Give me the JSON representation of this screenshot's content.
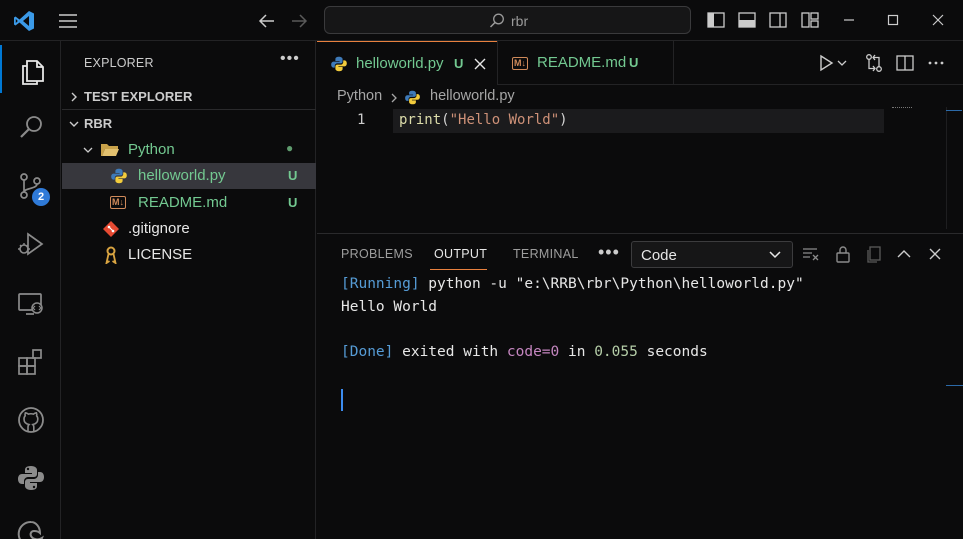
{
  "titlebar": {
    "search_text": "rbr",
    "icons": [
      "vscode-logo-icon",
      "menu-icon",
      "back-arrow-icon",
      "forward-arrow-icon",
      "search-icon",
      "toggle-primary-sidebar-icon",
      "toggle-panel-icon",
      "toggle-secondary-sidebar-icon",
      "customize-layout-icon",
      "minimize-icon",
      "maximize-icon",
      "close-icon"
    ]
  },
  "activity": {
    "items": [
      "explorer",
      "search",
      "source-control",
      "run-and-debug",
      "remote-explorer",
      "extensions",
      "github",
      "python",
      "edge-devtools"
    ],
    "scm_badge": "2"
  },
  "sidebar": {
    "title": "EXPLORER",
    "more": "•••",
    "sections": [
      {
        "label": "TEST EXPLORER",
        "expanded": false
      },
      {
        "label": "RBR",
        "expanded": true
      }
    ],
    "tree": [
      {
        "label": "Python",
        "type": "folder",
        "status": "●"
      },
      {
        "label": "helloworld.py",
        "type": "python",
        "status": "U"
      },
      {
        "label": "README.md",
        "type": "markdown",
        "status": "U"
      },
      {
        "label": ".gitignore",
        "type": "git",
        "status": ""
      },
      {
        "label": "LICENSE",
        "type": "license",
        "status": ""
      }
    ]
  },
  "editor": {
    "tabs": [
      {
        "label": "helloworld.py",
        "status": "U",
        "active": true
      },
      {
        "label": "README.md",
        "status": "U",
        "active": false
      }
    ],
    "md_icon_text": "M↓",
    "breadcrumb": [
      "Python",
      "helloworld.py"
    ],
    "lines": [
      {
        "num": "1",
        "fn": "print",
        "open": "(",
        "str": "\"Hello World\"",
        "close": ")"
      }
    ]
  },
  "panel": {
    "tabs": [
      "PROBLEMS",
      "OUTPUT",
      "TERMINAL"
    ],
    "active_tab": "OUTPUT",
    "more": "•••",
    "channel": "Code",
    "output": {
      "running_tag": "[Running]",
      "running_cmd": " python -u \"e:\\RRB\\rbr\\Python\\helloworld.py\"",
      "stdout": "Hello World",
      "done_tag": "[Done]",
      "done_mid": " exited with ",
      "done_code": "code=0",
      "done_in": " in ",
      "done_time": "0.055",
      "done_unit": " seconds"
    }
  },
  "colors": {
    "accent": "#0078d4",
    "git_untracked": "#73c991",
    "tab_indicator": "#e8813f",
    "badge": "#2f7ad8"
  }
}
